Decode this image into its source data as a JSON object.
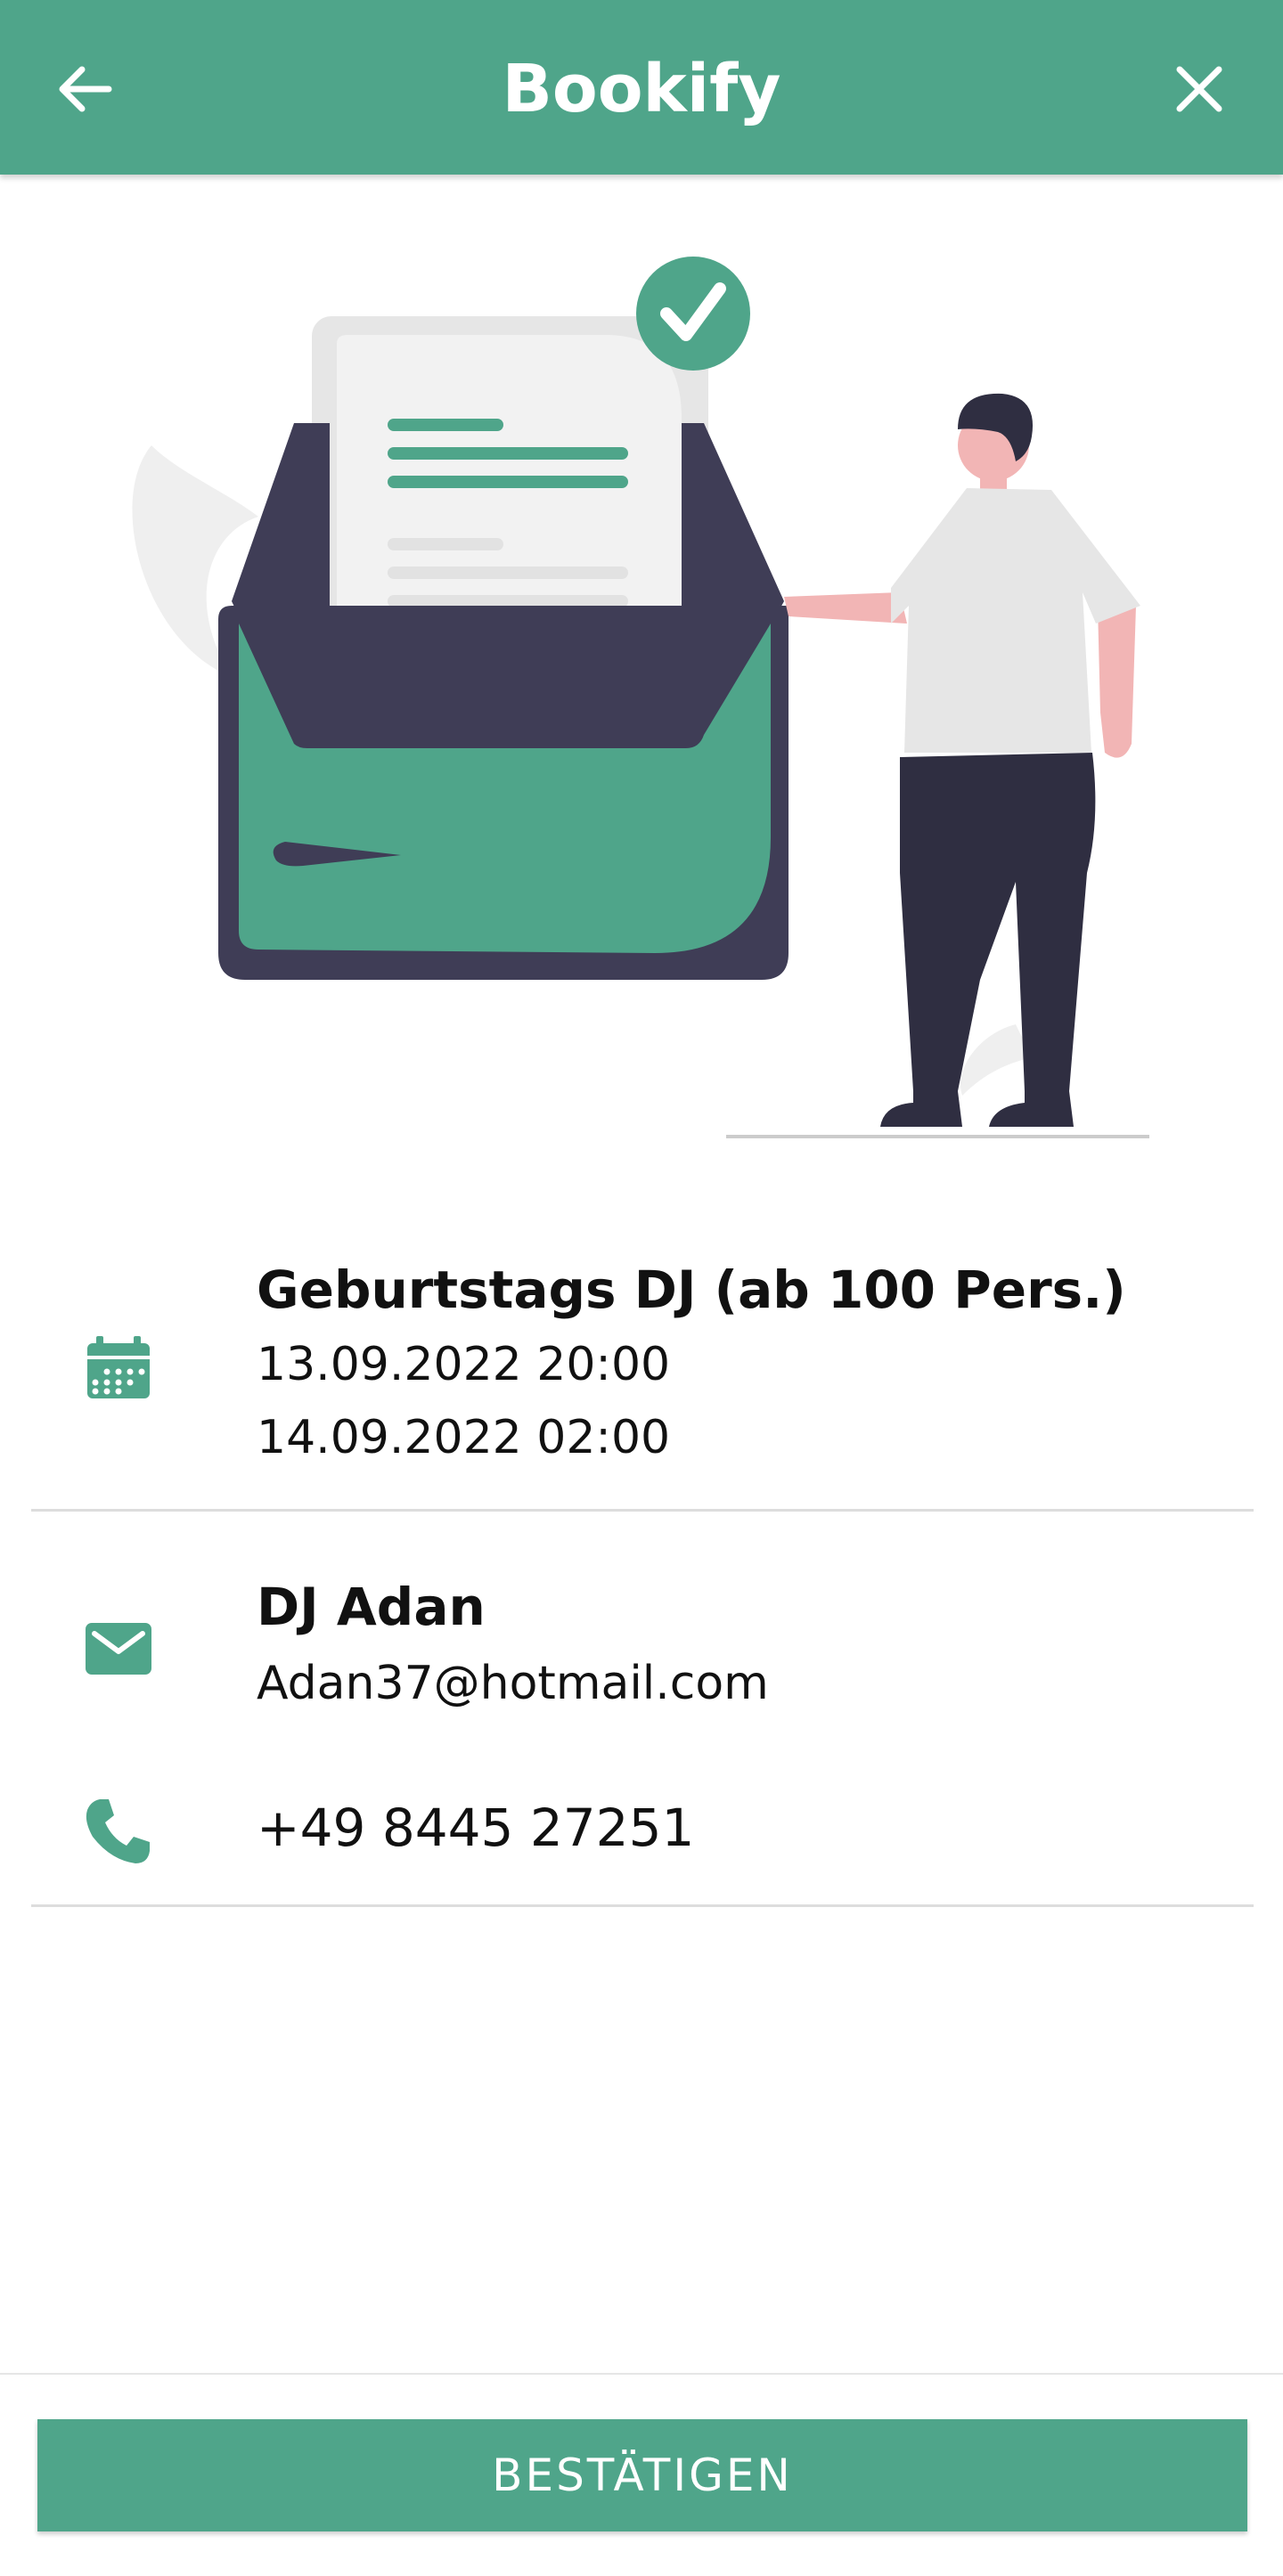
{
  "header": {
    "title": "Bookify",
    "back_icon": "arrow-left-icon",
    "close_icon": "close-icon"
  },
  "illustration": {
    "name": "booking-confirmed-illustration",
    "accent_color": "#4fa58a"
  },
  "event": {
    "icon": "calendar-icon",
    "title": "Geburtstags DJ (ab 100 Pers.)",
    "start": "13.09.2022 20:00",
    "end": "14.09.2022 02:00"
  },
  "contact": {
    "mail_icon": "mail-icon",
    "name": "DJ Adan",
    "email": "Adan37@hotmail.com",
    "phone_icon": "phone-icon",
    "phone": "+49 8445 27251"
  },
  "actions": {
    "confirm_label": "BESTÄTIGEN"
  },
  "colors": {
    "primary": "#4fa58a",
    "dark": "#3f3d56",
    "divider": "#dddddd"
  }
}
